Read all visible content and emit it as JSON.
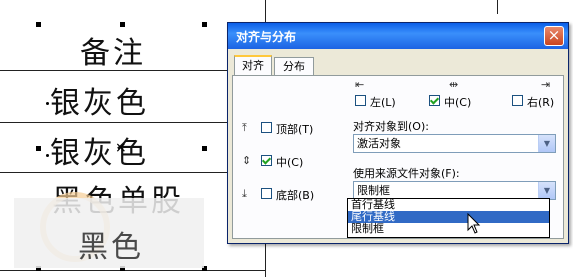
{
  "table": {
    "cells": [
      "备注",
      "银灰色",
      "银灰色",
      "黑色单股",
      "黑色"
    ]
  },
  "dialog": {
    "title": "对齐与分布",
    "close_glyph": "×",
    "tabs": [
      "对齐",
      "分布"
    ],
    "horizontal": {
      "left": "左(L)",
      "center": "中(C)",
      "right": "右(R)"
    },
    "vertical": {
      "top": "顶部(T)",
      "middle": "中(C)",
      "bottom": "底部(B)"
    },
    "align_to_label": "对齐对象到(O):",
    "align_to_value": "激活对象",
    "source_label": "使用来源文件对象(F):",
    "source_value": "限制框",
    "source_options": [
      "首行基线",
      "尾行基线",
      "限制框"
    ],
    "source_highlighted": "尾行基线"
  }
}
